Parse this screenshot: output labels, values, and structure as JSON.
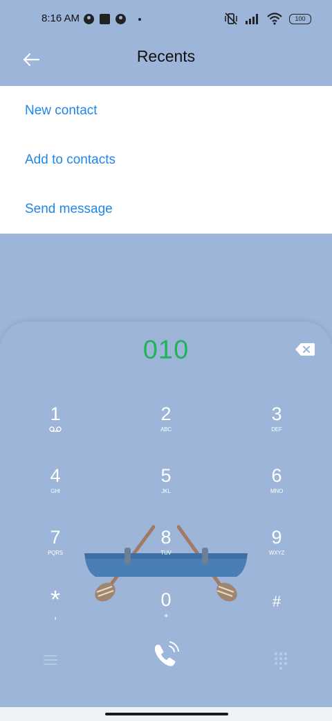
{
  "status_bar": {
    "time": "8:16 AM",
    "battery": "100",
    "icons": [
      "app-notification-icon",
      "square-notification-icon",
      "app-notification-icon",
      "dot-icon",
      "vibrate-off-icon",
      "signal-icon",
      "wifi-icon",
      "battery-icon"
    ]
  },
  "header": {
    "title": "Recents",
    "back_icon": "back-arrow-icon"
  },
  "menu": {
    "items": [
      {
        "label": "New contact"
      },
      {
        "label": "Add to contacts"
      },
      {
        "label": "Send message"
      }
    ]
  },
  "dialer": {
    "number": "010",
    "keys": [
      {
        "digit": "1",
        "letters": ""
      },
      {
        "digit": "2",
        "letters": "ABC"
      },
      {
        "digit": "3",
        "letters": "DEF"
      },
      {
        "digit": "4",
        "letters": "GHI"
      },
      {
        "digit": "5",
        "letters": "JKL"
      },
      {
        "digit": "6",
        "letters": "MNO"
      },
      {
        "digit": "7",
        "letters": "PQRS"
      },
      {
        "digit": "8",
        "letters": "TUV"
      },
      {
        "digit": "9",
        "letters": "WXYZ"
      },
      {
        "digit": "*",
        "letters": ","
      },
      {
        "digit": "0",
        "letters": "+"
      },
      {
        "digit": "#",
        "letters": ""
      }
    ],
    "colors": {
      "number": "#1fb35a",
      "background": "#9cb5d8",
      "accent_link": "#1e87e5"
    }
  }
}
